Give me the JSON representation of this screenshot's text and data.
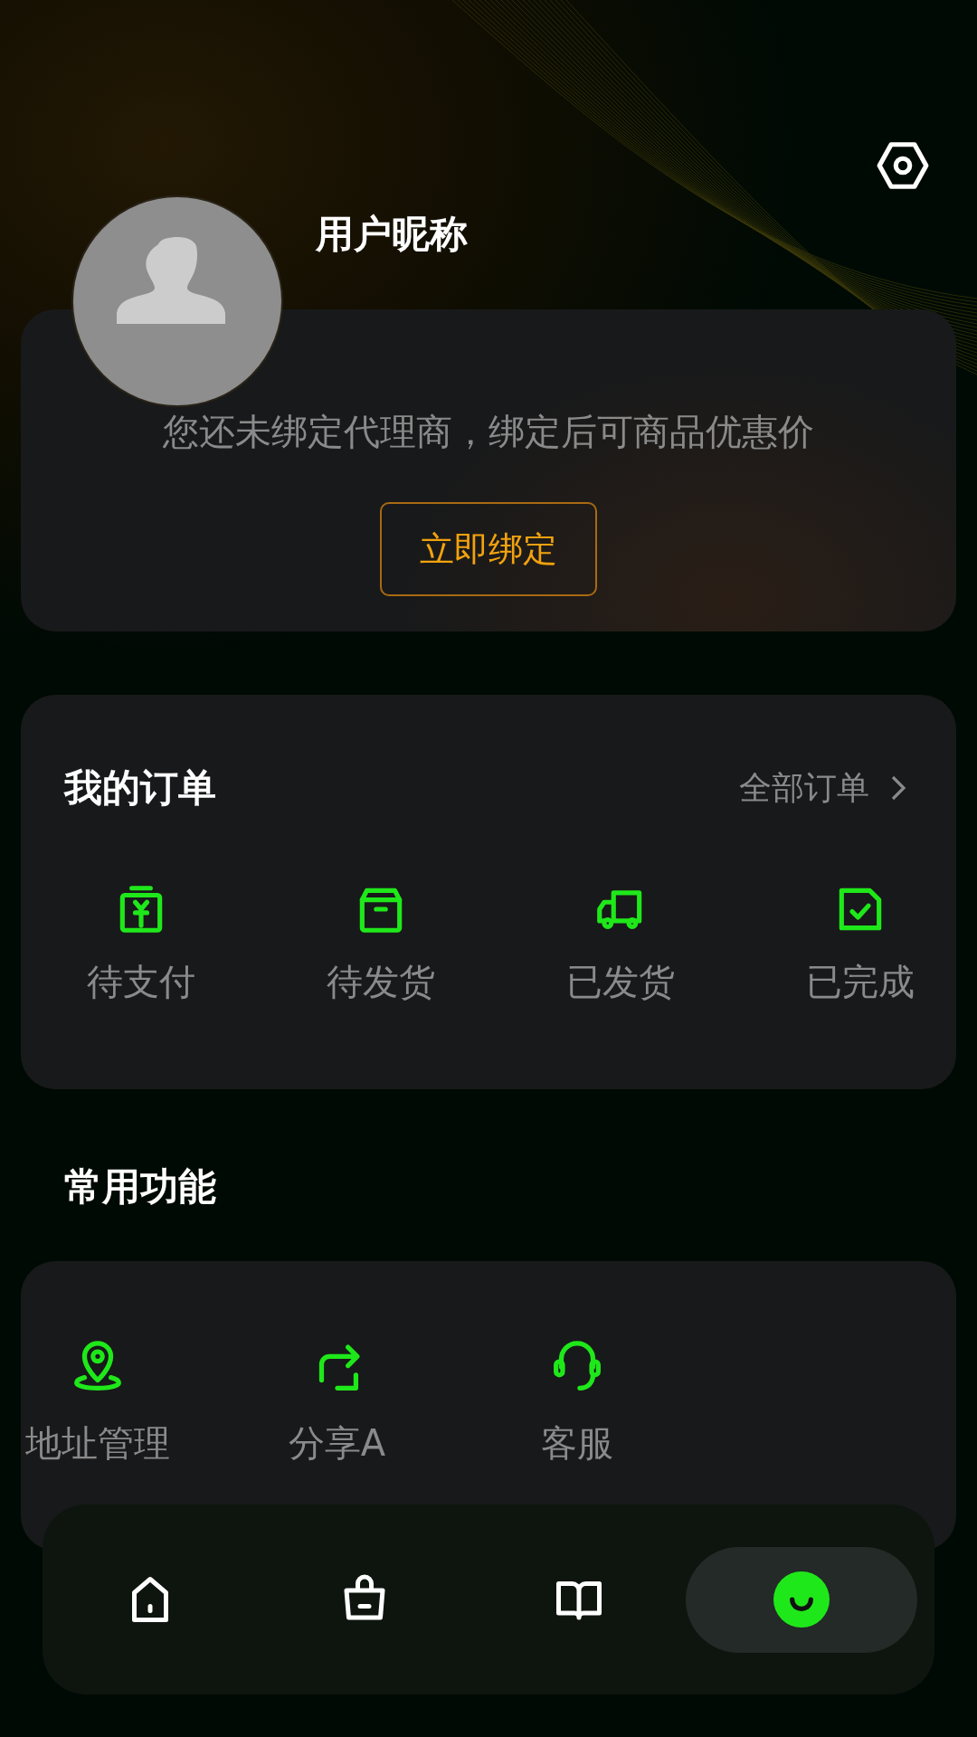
{
  "header": {
    "nickname": "用户昵称"
  },
  "agent_card": {
    "message": "您还未绑定代理商，绑定后可商品优惠价",
    "button": "立即绑定"
  },
  "orders": {
    "title": "我的订单",
    "all_link": "全部订单",
    "items": [
      {
        "label": "待支付",
        "kind": "pay"
      },
      {
        "label": "待发货",
        "kind": "box"
      },
      {
        "label": "已发货",
        "kind": "truck"
      },
      {
        "label": "已完成",
        "kind": "done"
      }
    ]
  },
  "functions": {
    "title": "常用功能",
    "items": [
      {
        "label": "地址管理",
        "kind": "address"
      },
      {
        "label": "分享A",
        "kind": "share"
      },
      {
        "label": "客服",
        "kind": "service"
      }
    ]
  },
  "nav": {
    "items": [
      {
        "kind": "home",
        "selected": false
      },
      {
        "kind": "shop",
        "selected": false
      },
      {
        "kind": "book",
        "selected": false
      },
      {
        "kind": "profile",
        "selected": true
      }
    ]
  }
}
